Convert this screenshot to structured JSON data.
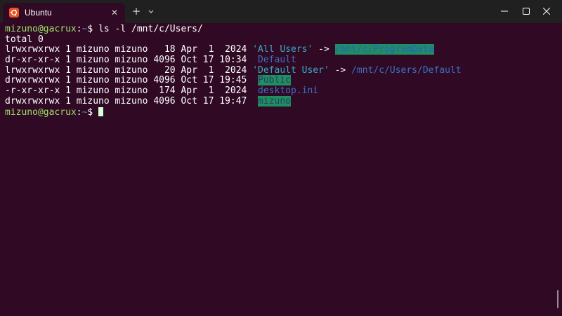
{
  "window": {
    "tab_title": "Ubuntu",
    "tab_icon": "ubuntu-logo-icon",
    "accent": "#e95420",
    "background": "#300a24"
  },
  "titlebar": {
    "close_tab_symbol": "✕",
    "new_tab_symbol": "+"
  },
  "terminal": {
    "prompt_user": "mizuno@gacrux",
    "prompt_sep": ":",
    "prompt_path": "~",
    "prompt_symbol": "$ ",
    "command": "ls -l /mnt/c/Users/",
    "total": "total 0",
    "entries": [
      {
        "info": "lrwxrwxrwx 1 mizuno mizuno   18 Apr  1  2024 ",
        "name": "'All Users'",
        "arrow": " -> ",
        "target": "/mnt/c/ProgramData"
      },
      {
        "info": "dr-xr-xr-x 1 mizuno mizuno 4096 Oct 17 10:34  ",
        "name": "Default"
      },
      {
        "info": "lrwxrwxrwx 1 mizuno mizuno   20 Apr  1  2024 ",
        "name": "'Default User'",
        "arrow": " -> ",
        "target": "/mnt/c/Users/Default"
      },
      {
        "info": "drwxrwxrwx 1 mizuno mizuno 4096 Oct 17 19:45  ",
        "name": "Public"
      },
      {
        "info": "-r-xr-xr-x 1 mizuno mizuno  174 Apr  1  2024  ",
        "name": "desktop.ini"
      },
      {
        "info": "drwxrwxrwx 1 mizuno mizuno 4096 Oct 17 19:47  ",
        "name": "mizuno"
      }
    ]
  }
}
